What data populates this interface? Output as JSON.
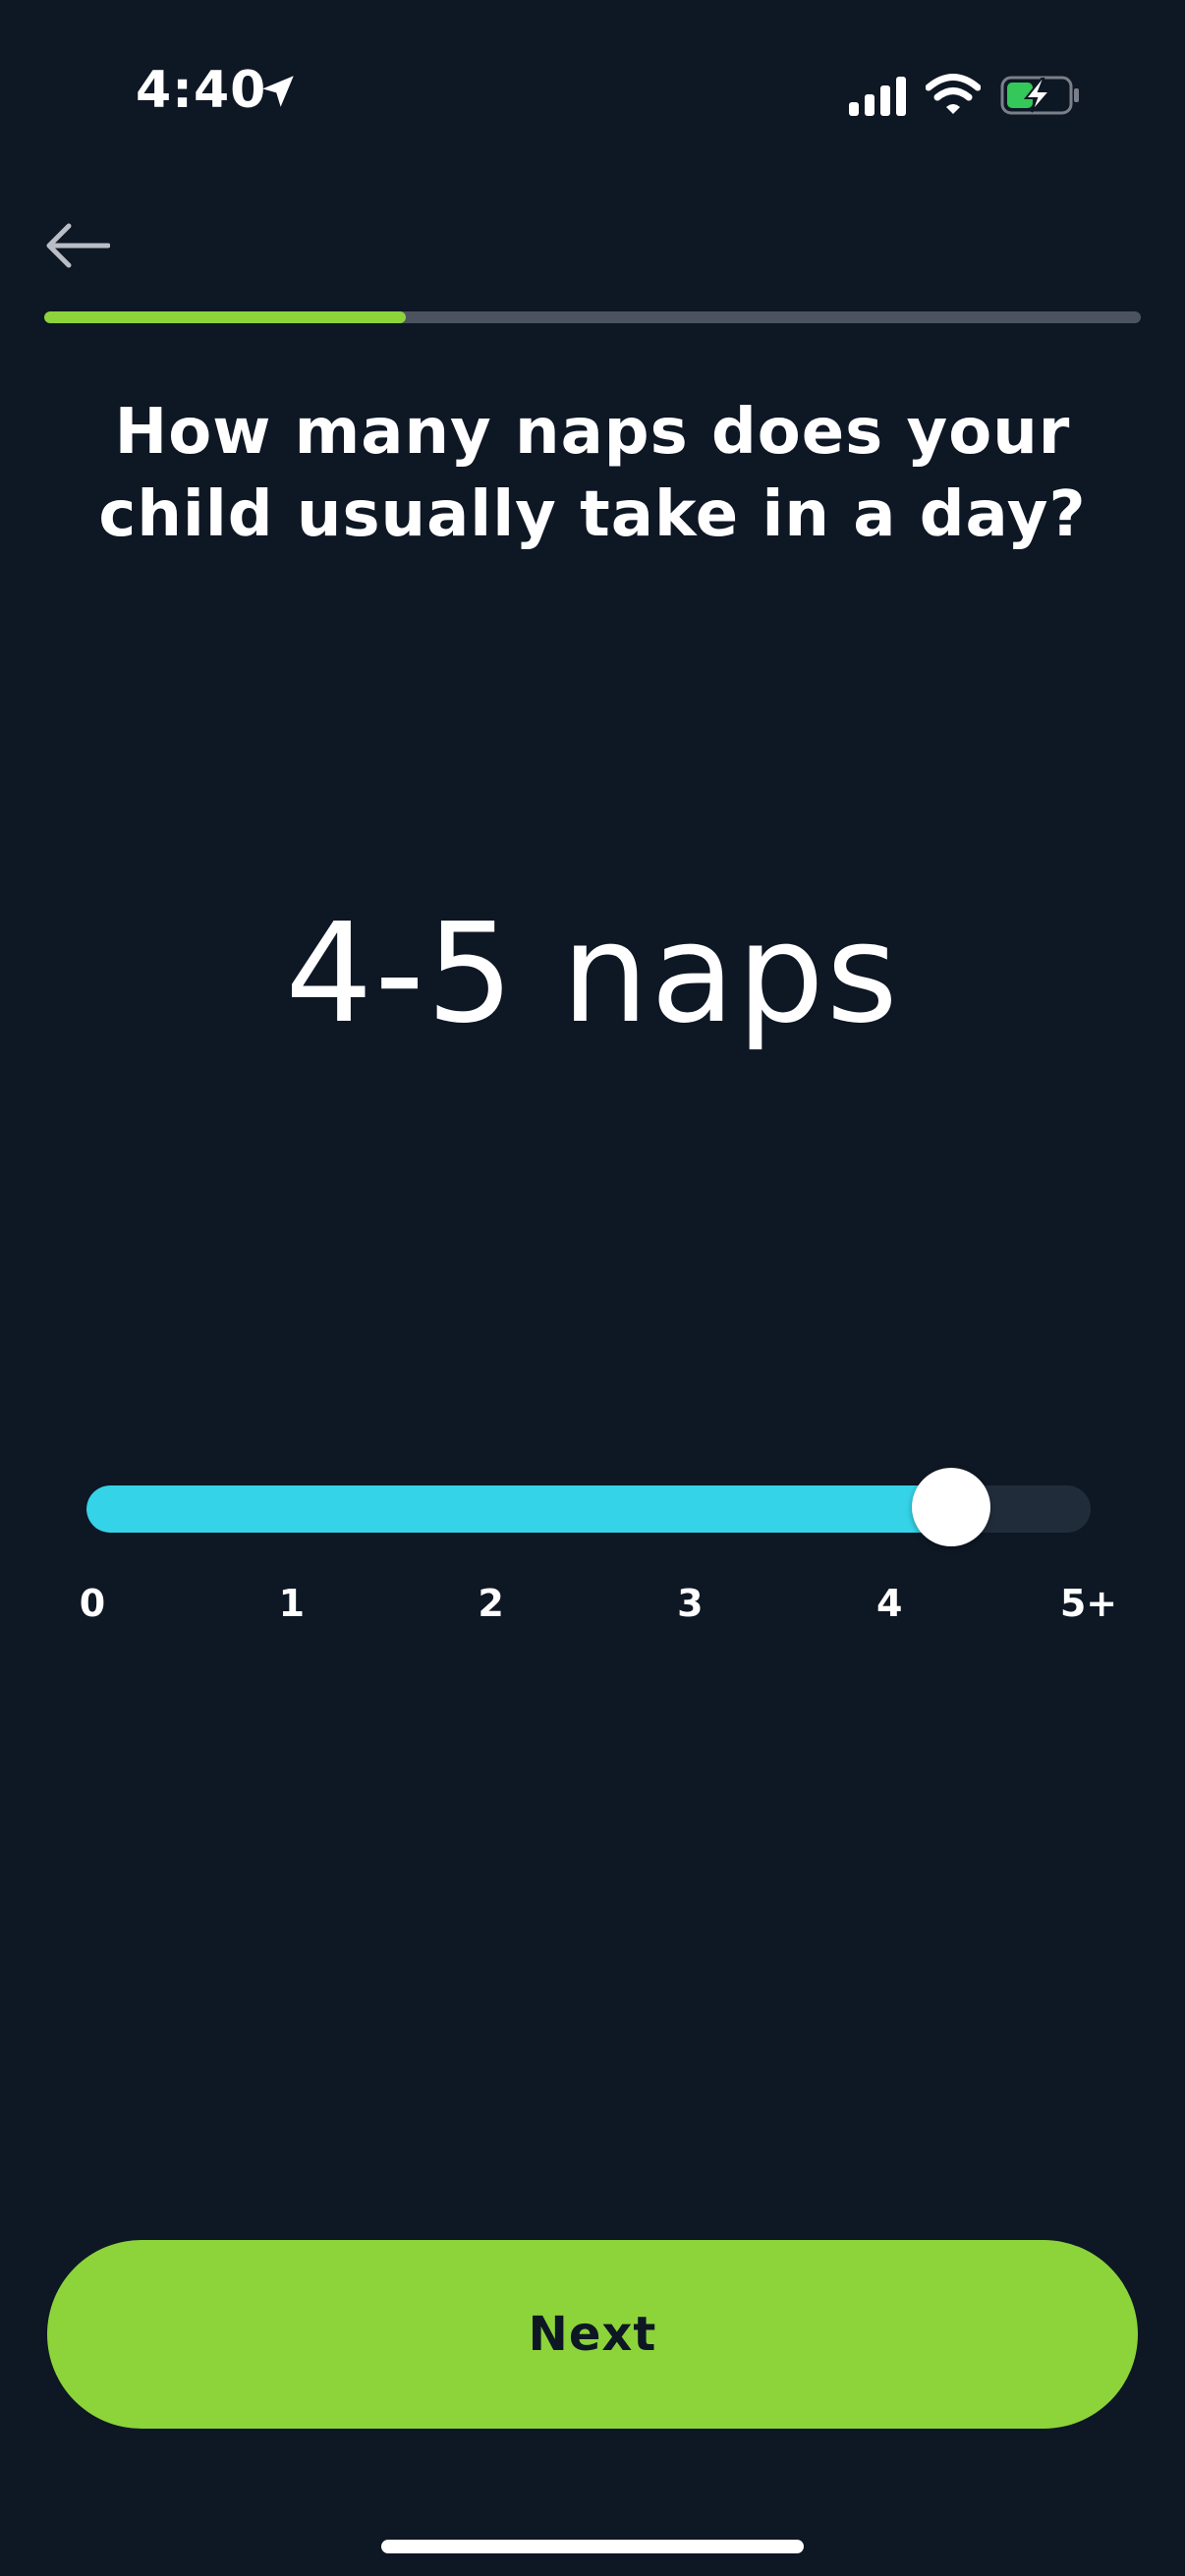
{
  "status_bar": {
    "time": "4:40",
    "battery_charging": true
  },
  "header": {
    "back_icon": "arrow-left-icon",
    "progress_percent": 33
  },
  "question": {
    "text": "How many naps does your child usually take in a day?"
  },
  "selection": {
    "value_text": "4-5 naps"
  },
  "slider": {
    "min": 0,
    "max": 5,
    "value": 4.5,
    "tick_labels": [
      "0",
      "1",
      "2",
      "3",
      "4",
      "5+"
    ]
  },
  "footer": {
    "next_label": "Next"
  },
  "colors": {
    "background": "#0e1724",
    "accent_green": "#8cd43a",
    "slider_cyan": "#35d3e7",
    "track_gray": "#4b5361"
  }
}
